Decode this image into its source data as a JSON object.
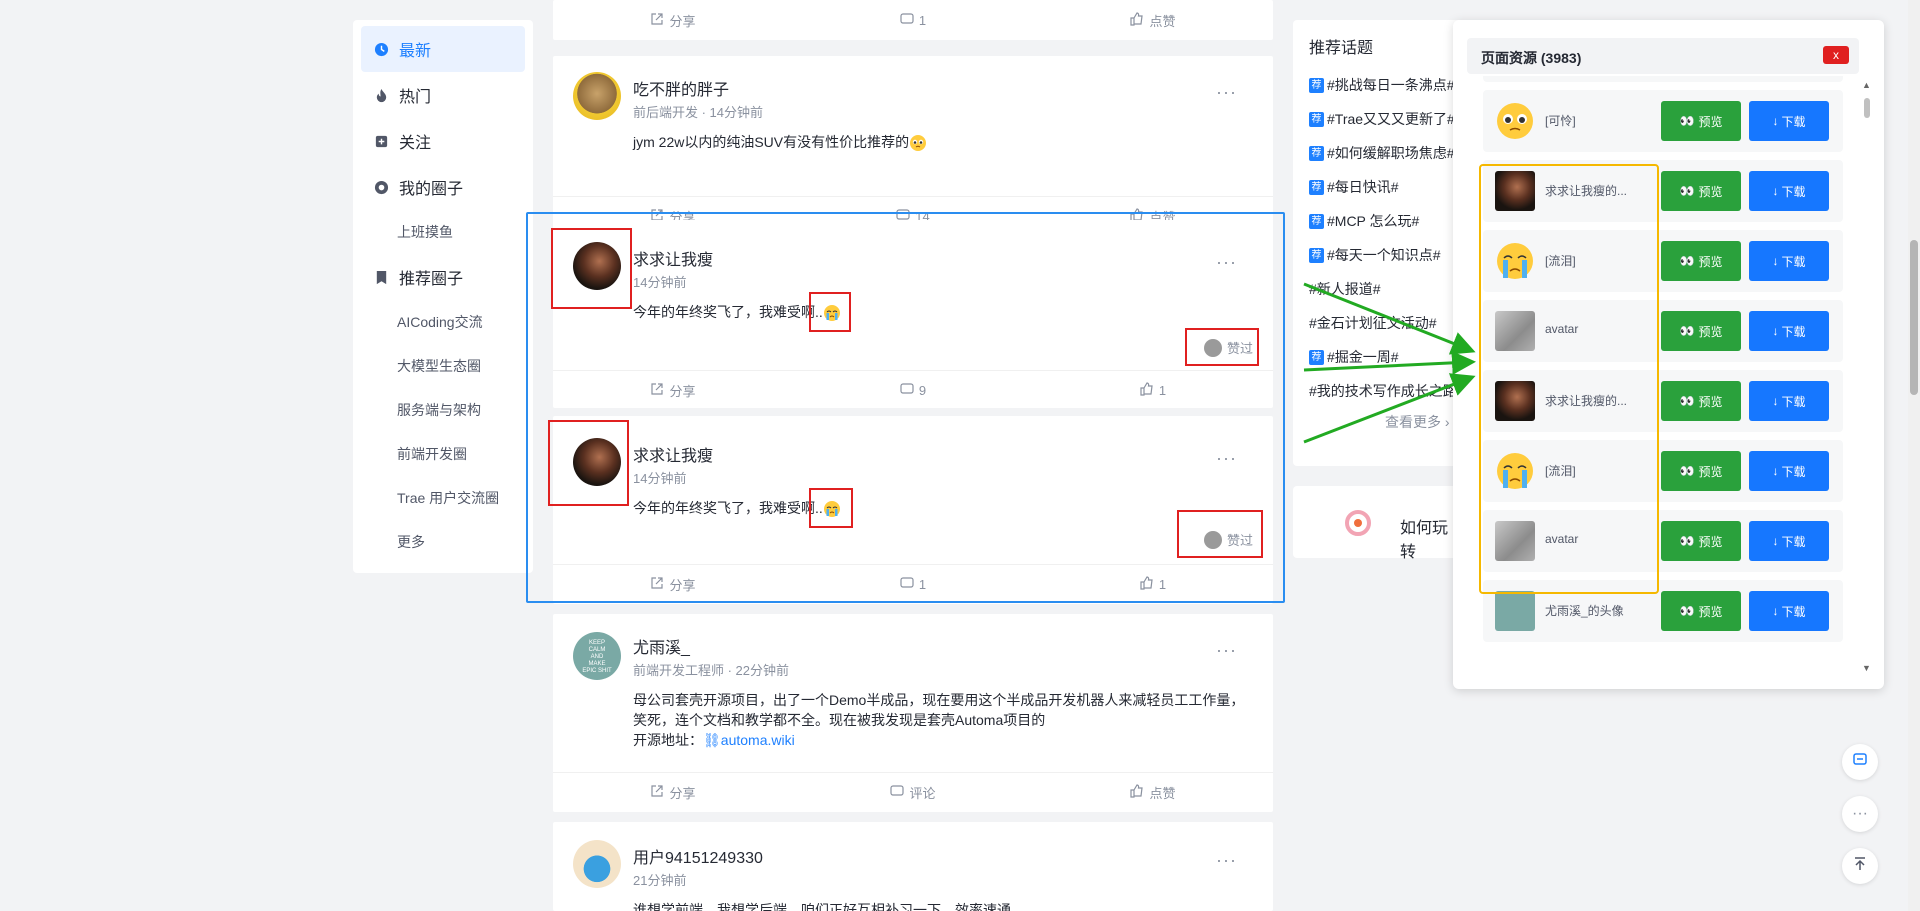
{
  "left_nav": {
    "items": [
      {
        "label": "最新"
      },
      {
        "label": "热门"
      },
      {
        "label": "关注"
      },
      {
        "label": "我的圈子"
      }
    ],
    "my_sub": "上班摸鱼",
    "recommend_label": "推荐圈子",
    "recommend": [
      "AICoding交流",
      "大模型生态圈",
      "服务端与架构",
      "前端开发圈",
      "Trae 用户交流圈",
      "更多"
    ]
  },
  "feed": {
    "top": {
      "share": "分享",
      "comments": "1",
      "like": "点赞"
    },
    "posts": [
      {
        "name": "吃不胖的胖子",
        "meta": "前后端开发 · 14分钟前",
        "text": "jym 22w以内的纯油SUV有没有性价比推荐的",
        "share": "分享",
        "comments": "14",
        "like": "点赞"
      },
      {
        "name": "求求让我瘦",
        "meta": "14分钟前",
        "text": "今年的年终奖飞了，我难受啊..",
        "liked": "赞过",
        "share": "分享",
        "comments": "9",
        "like": "1"
      },
      {
        "name": "求求让我瘦",
        "meta": "14分钟前",
        "text": "今年的年终奖飞了，我难受啊..",
        "liked": "赞过",
        "share": "分享",
        "comments": "1",
        "like": "1"
      },
      {
        "name": "尤雨溪_",
        "meta": "前端开发工程师 · 22分钟前",
        "text1": "母公司套壳开源项目，出了一个Demo半成品，现在要用这个半成品开发机器人来减轻员工工作量，",
        "text2": "笑死，连个文档和教学都不全。现在被我发现是套壳Automa项目的",
        "text3": "开源地址：",
        "link": "automa.wiki",
        "share": "分享",
        "comments": "评论",
        "like": "点赞"
      },
      {
        "name": "用户94151249330",
        "meta": "21分钟前",
        "text": "谁想学前端，我想学后端，咱们正好互相补习一下，效率速通"
      }
    ],
    "avatar_text": {
      "keep": "KEEP",
      "calm": "CALM",
      "and": "AND",
      "make": "MAKE",
      "epic": "EPIC SHIT"
    }
  },
  "topics": {
    "title": "推荐话题",
    "tag_char": "荐",
    "items": [
      {
        "text": "#挑战每日一条沸点#",
        "tag": true
      },
      {
        "text": "#Trae又又又更新了#",
        "tag": true
      },
      {
        "text": "#如何缓解职场焦虑#",
        "tag": true
      },
      {
        "text": "#每日快讯#",
        "tag": true
      },
      {
        "text": "#MCP 怎么玩#",
        "tag": true
      },
      {
        "text": "#每天一个知识点#",
        "tag": true
      },
      {
        "text": "#新人报道#",
        "tag": false
      },
      {
        "text": "#金石计划征文活动#",
        "tag": false
      },
      {
        "text": "#掘金一周#",
        "tag": true
      },
      {
        "text": "#我的技术写作成长之路#",
        "tag": false
      }
    ],
    "see_more": "查看更多",
    "bottom_text": "如何玩转"
  },
  "resource_panel": {
    "title": "页面资源 (3983)",
    "close": "x",
    "preview": "预览",
    "download": "下载",
    "rows": [
      {
        "name": "[可怜]",
        "thumb": "pleading"
      },
      {
        "name": "求求让我瘦的...",
        "thumb": "dark"
      },
      {
        "name": "[流泪]",
        "thumb": "crying"
      },
      {
        "name": "avatar",
        "thumb": "gray"
      },
      {
        "name": "求求让我瘦的...",
        "thumb": "dark"
      },
      {
        "name": "[流泪]",
        "thumb": "crying"
      },
      {
        "name": "avatar",
        "thumb": "gray"
      },
      {
        "name": "尤雨溪_的头像",
        "thumb": "keepcalm"
      }
    ]
  },
  "colors": {
    "accent": "#1e80ff",
    "annotation_red": "#e02020",
    "annotation_blue": "#2a8df0",
    "annotation_yellow": "#f5b800",
    "arrow_green": "#22aa22",
    "preview_green": "#2aa13c",
    "download_blue": "#1677ff"
  }
}
